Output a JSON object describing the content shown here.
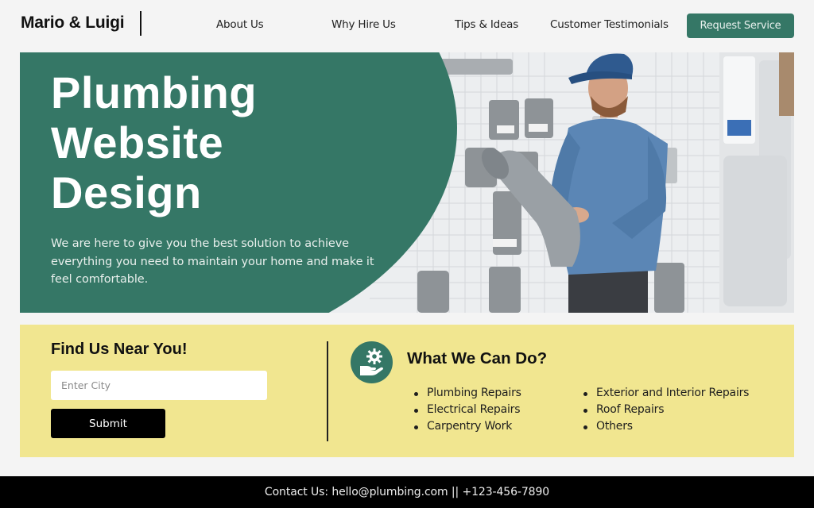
{
  "header": {
    "logo": "Mario & Luigi",
    "nav": [
      {
        "label": "About Us"
      },
      {
        "label": "Why Hire Us"
      },
      {
        "label": "Tips & Ideas"
      },
      {
        "label": "Customer Testimonials"
      }
    ],
    "cta_label": "Request Service"
  },
  "hero": {
    "title_lines": [
      "Plumbing",
      "Website",
      "Design"
    ],
    "description": "We are here to give you the best solution to achieve everything you need to maintain your home and make it feel comfortable.",
    "image_alt": "Plumber in blue cap and denim shirt holding a grey pipe fitting in a plumbing store"
  },
  "find": {
    "title": "Find Us Near You!",
    "input_placeholder": "Enter City",
    "input_value": "",
    "submit_label": "Submit"
  },
  "services": {
    "icon": "hand-gear-icon",
    "title": "What We Can Do?",
    "col1": [
      "Plumbing Repairs",
      "Electrical Repairs",
      "Carpentry Work"
    ],
    "col2": [
      "Exterior and Interior Repairs",
      "Roof Repairs",
      "Others"
    ]
  },
  "footer": {
    "contact": "Contact Us: hello@plumbing.com || +123-456-7890"
  },
  "colors": {
    "brand_green": "#357766",
    "band_yellow": "#f1e690",
    "background": "#f4f4f4",
    "footer": "#000000"
  }
}
